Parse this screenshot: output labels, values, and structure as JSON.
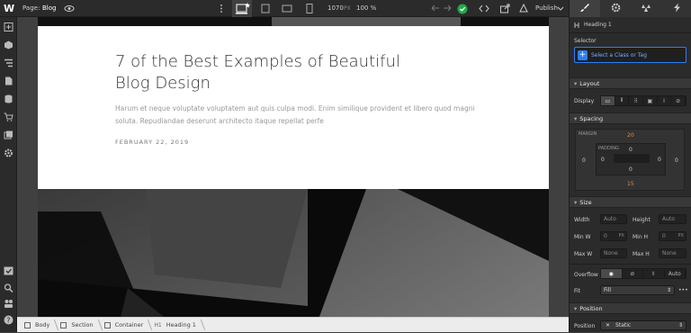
{
  "topbar": {
    "logo": "W",
    "page_label": "Page:",
    "page_name": "Blog",
    "width_value": "1070",
    "width_unit": "PX",
    "zoom": "100 %",
    "publish_label": "Publish"
  },
  "left_icons": [
    "add-icon",
    "box-icon",
    "navigator-icon",
    "pages-icon",
    "cms-icon",
    "ecommerce-icon",
    "assets-icon",
    "settings-icon",
    "tasks-icon",
    "search-icon",
    "team-icon",
    "help-icon"
  ],
  "post": {
    "title": "7 of the Best Examples of Beautiful Blog Design",
    "excerpt": "Harum et neque voluptate voluptatem aut quis culpa modi. Enim similique provident et libero quod magni soluta. Repudiandae deserunt architecto itaque repellat perfe",
    "date": "FEBRUARY 22, 2019"
  },
  "breadcrumb": [
    "Body",
    "Section",
    "Container",
    "Heading 1"
  ],
  "panel": {
    "element_name": "Heading 1",
    "selector_label": "Selector",
    "selector_placeholder": "Select a Class or Tag",
    "layout_head": "Layout",
    "display_label": "Display",
    "spacing_head": "Spacing",
    "margin_label": "MARGIN",
    "padding_label": "PADDING",
    "margin_top": "20",
    "margin_bottom": "15",
    "margin_left": "0",
    "margin_right": "0",
    "padding_top": "0",
    "padding_bottom": "0",
    "padding_left": "0",
    "padding_right": "0",
    "size_head": "Size",
    "width_label": "Width",
    "height_label": "Height",
    "minw_label": "Min W",
    "minh_label": "Min H",
    "maxw_label": "Max W",
    "maxh_label": "Max H",
    "auto": "Auto",
    "zero": "0",
    "px": "PX",
    "none": "None",
    "overflow_label": "Overflow",
    "overflow_auto": "Auto",
    "fit_label": "Fit",
    "fit_value": "Fill",
    "position_head": "Position",
    "position_label": "Position",
    "position_value": "Static"
  },
  "colors": {
    "accent": "#2d7ff9",
    "status_green": "#22a94a",
    "margin_orange": "#e8873a"
  }
}
